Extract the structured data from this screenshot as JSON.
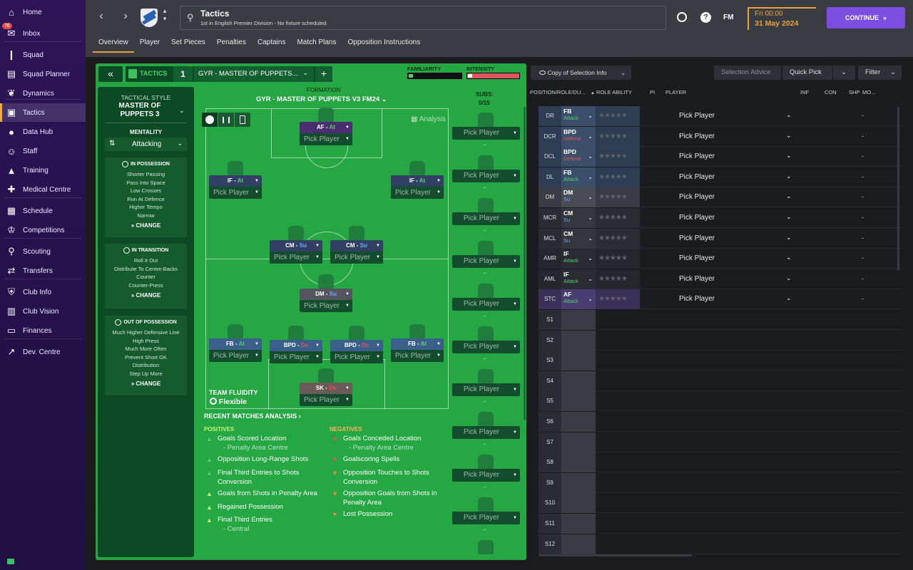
{
  "nav": {
    "items": [
      {
        "label": "Home",
        "icon": "home-icon"
      },
      {
        "label": "Inbox",
        "icon": "inbox-icon",
        "badge": "76"
      },
      {
        "label": "Squad",
        "icon": "shirt-icon"
      },
      {
        "label": "Squad Planner",
        "icon": "planner-icon"
      },
      {
        "label": "Dynamics",
        "icon": "dynamics-icon"
      },
      {
        "label": "Tactics",
        "icon": "tactics-icon"
      },
      {
        "label": "Data Hub",
        "icon": "data-hub-icon"
      },
      {
        "label": "Staff",
        "icon": "staff-icon"
      },
      {
        "label": "Training",
        "icon": "training-icon"
      },
      {
        "label": "Medical Centre",
        "icon": "medical-icon"
      },
      {
        "label": "Schedule",
        "icon": "calendar-icon"
      },
      {
        "label": "Competitions",
        "icon": "trophy-icon"
      },
      {
        "label": "Scouting",
        "icon": "search-icon"
      },
      {
        "label": "Transfers",
        "icon": "transfers-icon"
      },
      {
        "label": "Club Info",
        "icon": "shield-icon"
      },
      {
        "label": "Club Vision",
        "icon": "briefcase-icon"
      },
      {
        "label": "Finances",
        "icon": "money-icon"
      },
      {
        "label": "Dev. Centre",
        "icon": "dev-centre-icon"
      }
    ]
  },
  "header": {
    "title": "Tactics",
    "subtitle": "1st in English Premier Division - No fixture scheduled.",
    "fm": "FM",
    "time": "Fri 00:00",
    "date": "31 May 2024",
    "continue": "CONTINUE"
  },
  "tabs": [
    "Overview",
    "Player",
    "Set Pieces",
    "Penalties",
    "Captains",
    "Match Plans",
    "Opposition Instructions"
  ],
  "tactics_bar": {
    "label": "TACTICS",
    "slot": "1",
    "name": "GYR - MASTER OF PUPPETS...",
    "familiarity": "FAMILIARITY",
    "intensity": "INTENSITY"
  },
  "style": {
    "title": "TACTICAL STYLE",
    "name": "MASTER OF PUPPETS 3",
    "mentality_label": "MENTALITY",
    "mentality": "Attacking"
  },
  "in_possession": {
    "title": "IN POSSESSION",
    "lines": [
      "Shorter Passing",
      "Pass Into Space",
      "Low Crosses",
      "Run At Defence",
      "Higher Tempo",
      "Narrow"
    ],
    "change": "CHANGE"
  },
  "in_transition": {
    "title": "IN TRANSITION",
    "lines": [
      "Roll It Out",
      "Distribute To Centre-Backs",
      "Counter",
      "Counter-Press"
    ],
    "change": "CHANGE"
  },
  "out_possession": {
    "title": "OUT OF POSSESSION",
    "lines": [
      "Much Higher Defensive Line",
      "High Press",
      "Much More Often",
      "Prevent Short GK",
      "Distribution",
      "Step Up More"
    ],
    "change": "CHANGE"
  },
  "formation": {
    "label": "FORMATION",
    "name": "GYR - MASTER OF PUPPETS V3 FM24",
    "subs_label": "SUBS:",
    "subs": "0/15",
    "analysis": "Analysis",
    "fluidity_label": "TEAM FLUIDITY",
    "fluidity": "Flexible"
  },
  "pitch_players": [
    {
      "role": "AF",
      "duty": "At",
      "pick": "Pick Player"
    },
    {
      "role": "IF",
      "duty": "At",
      "pick": "Pick Player"
    },
    {
      "role": "IF",
      "duty": "At",
      "pick": "Pick Player"
    },
    {
      "role": "CM",
      "duty": "Su",
      "pick": "Pick Player"
    },
    {
      "role": "CM",
      "duty": "Su",
      "pick": "Pick Player"
    },
    {
      "role": "DM",
      "duty": "Su",
      "pick": "Pick Player"
    },
    {
      "role": "FB",
      "duty": "At",
      "pick": "Pick Player"
    },
    {
      "role": "BPD",
      "duty": "De",
      "pick": "Pick Player"
    },
    {
      "role": "BPD",
      "duty": "De",
      "pick": "Pick Player"
    },
    {
      "role": "FB",
      "duty": "At",
      "pick": "Pick Player"
    },
    {
      "role": "SK",
      "duty": "De",
      "pick": "Pick Player"
    }
  ],
  "subs_pick": "Pick Player",
  "subs_dash": "-",
  "recent": {
    "title": "RECENT MATCHES ANALYSIS",
    "positives_label": "POSITIVES",
    "negatives_label": "NEGATIVES",
    "positives": [
      {
        "t": "Goals Scored Location",
        "s": "- Penalty Area Centre"
      },
      {
        "t": "Opposition Long-Range Shots",
        "s": ""
      },
      {
        "t": "Final Third Entries to Shots Conversion",
        "s": ""
      },
      {
        "t": "Goals from Shots in Penalty Area",
        "s": ""
      },
      {
        "t": "Regained Possession",
        "s": ""
      },
      {
        "t": "Final Third Entries",
        "s": "- Central"
      }
    ],
    "negatives": [
      {
        "t": "Goals Conceded Location",
        "s": "- Penalty Area Centre"
      },
      {
        "t": "Goalscoring Spells",
        "s": ""
      },
      {
        "t": "Opposition Touches to Shots Conversion",
        "s": ""
      },
      {
        "t": "Opposition Goals from Shots in Penalty Area",
        "s": ""
      },
      {
        "t": "Lost Possession",
        "s": ""
      }
    ]
  },
  "right": {
    "copy": "Copy of Selection Info",
    "advice": "Selection Advice",
    "quick": "Quick Pick",
    "filter": "Filter",
    "cols": {
      "pos": "POSITION/ROLE/DU...",
      "ability": "ROLE ABILITY",
      "pi": "PI",
      "player": "PLAYER",
      "inf": "INF",
      "con": "CON",
      "shp": "SHP",
      "mo": "MO..."
    },
    "rows": [
      {
        "pos": "DR",
        "role": "FB",
        "duty": "Attack"
      },
      {
        "pos": "DCR",
        "role": "BPD",
        "duty": "Defend"
      },
      {
        "pos": "DCL",
        "role": "BPD",
        "duty": "Defend"
      },
      {
        "pos": "DL",
        "role": "FB",
        "duty": "Attack"
      },
      {
        "pos": "DM",
        "role": "DM",
        "duty": "Su"
      },
      {
        "pos": "MCR",
        "role": "CM",
        "duty": "Su"
      },
      {
        "pos": "MCL",
        "role": "CM",
        "duty": "Su"
      },
      {
        "pos": "AMR",
        "role": "IF",
        "duty": "Attack"
      },
      {
        "pos": "AML",
        "role": "IF",
        "duty": "Attack"
      },
      {
        "pos": "STC",
        "role": "AF",
        "duty": "Attack"
      },
      {
        "pos": "S1",
        "role": "",
        "duty": ""
      },
      {
        "pos": "S2",
        "role": "",
        "duty": ""
      },
      {
        "pos": "S3",
        "role": "",
        "duty": ""
      },
      {
        "pos": "S4",
        "role": "",
        "duty": ""
      },
      {
        "pos": "S5",
        "role": "",
        "duty": ""
      },
      {
        "pos": "S6",
        "role": "",
        "duty": ""
      },
      {
        "pos": "S7",
        "role": "",
        "duty": ""
      },
      {
        "pos": "S8",
        "role": "",
        "duty": ""
      },
      {
        "pos": "S9",
        "role": "",
        "duty": ""
      },
      {
        "pos": "S10",
        "role": "",
        "duty": ""
      },
      {
        "pos": "S11",
        "role": "",
        "duty": ""
      },
      {
        "pos": "S12",
        "role": "",
        "duty": ""
      }
    ],
    "pick": "Pick Player",
    "dash": "-"
  },
  "colors": {
    "accent": "#7c4ee0",
    "highlight": "#e7a33a",
    "attack": "#4fd36b",
    "defend": "#e05555",
    "support": "#6fa8ff"
  }
}
